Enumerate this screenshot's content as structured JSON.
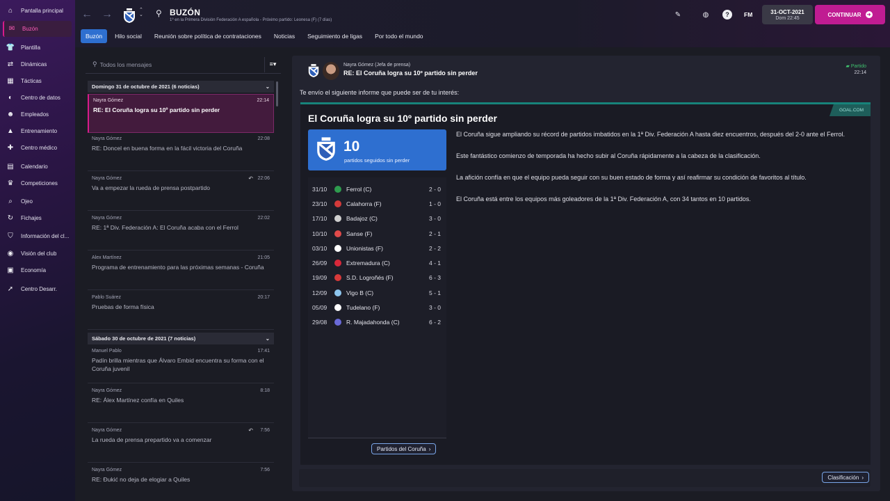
{
  "sidebar": {
    "items": [
      {
        "label": "Pantalla principal",
        "icon": "home-icon",
        "glyph": "⌂"
      },
      {
        "label": "Buzón",
        "icon": "inbox-icon",
        "glyph": "✉"
      },
      {
        "label": "Plantilla",
        "icon": "shirt-icon",
        "glyph": "👕"
      },
      {
        "label": "Dinámicas",
        "icon": "dynamics-icon",
        "glyph": "⇄"
      },
      {
        "label": "Tácticas",
        "icon": "tactics-icon",
        "glyph": "▦"
      },
      {
        "label": "Centro de datos",
        "icon": "data-hub-icon",
        "glyph": "◐"
      },
      {
        "label": "Empleados",
        "icon": "staff-icon",
        "glyph": "☻"
      },
      {
        "label": "Entrenamiento",
        "icon": "training-icon",
        "glyph": "▲"
      },
      {
        "label": "Centro médico",
        "icon": "medical-icon",
        "glyph": "✚"
      },
      {
        "label": "Calendario",
        "icon": "calendar-icon",
        "glyph": "▤"
      },
      {
        "label": "Competiciones",
        "icon": "trophy-icon",
        "glyph": "♛"
      },
      {
        "label": "Ojeo",
        "icon": "scouting-icon",
        "glyph": "⌕"
      },
      {
        "label": "Fichajes",
        "icon": "transfers-icon",
        "glyph": "↻"
      },
      {
        "label": "Información del cl...",
        "icon": "club-info-icon",
        "glyph": "⛉"
      },
      {
        "label": "Visión del club",
        "icon": "club-vision-icon",
        "glyph": "◉"
      },
      {
        "label": "Economía",
        "icon": "finances-icon",
        "glyph": "▣"
      },
      {
        "label": "Centro Desarr.",
        "icon": "development-icon",
        "glyph": "➚"
      }
    ]
  },
  "header": {
    "title": "BUZÓN",
    "subtitle": "1º en la Primera División Federación A española - Próximo partido: Leonesa (F)  (7 días)",
    "tabs": [
      "Buzón",
      "Hilo social",
      "Reunión sobre política de contrataciones",
      "Noticias",
      "Seguimiento de ligas",
      "Por todo el mundo"
    ],
    "fm_label": "FM",
    "date": "31-OCT-2021",
    "time": "Dom 22:45",
    "continue_label": "CONTINUAR"
  },
  "inbox": {
    "search_placeholder": "Todos los mensajes",
    "groups": [
      {
        "header": "Domingo 31 de octubre de 2021 (6 noticias)"
      },
      {
        "header": "Sábado 30 de octubre de 2021 (7 noticias)"
      }
    ],
    "messages": [
      {
        "from": "Nayra Gómez",
        "time": "22:14",
        "subject": "RE: El Coruña logra su 10º partido sin perder"
      },
      {
        "from": "Nayra Gómez",
        "time": "22:08",
        "subject": "RE: Doncel en buena forma en la fácil victoria del Coruña"
      },
      {
        "from": "Nayra Gómez",
        "time": "22:06",
        "subject": "Va a empezar la rueda de prensa postpartido"
      },
      {
        "from": "Nayra Gómez",
        "time": "22:02",
        "subject": "RE: 1ª Div. Federación A: El Coruña acaba con el Ferrol"
      },
      {
        "from": "Alex Martínez",
        "time": "21:05",
        "subject": "Programa de entrenamiento para las próximas semanas - Coruña"
      },
      {
        "from": "Pablo Suárez",
        "time": "20:17",
        "subject": "Pruebas de forma física"
      },
      {
        "from": "Manuel Pablo",
        "time": "17:41",
        "subject": "Padín brilla mientras que Álvaro Embid encuentra su forma con el Coruña juvenil"
      },
      {
        "from": "Nayra Gómez",
        "time": "8:18",
        "subject": "RE: Álex Martínez confía en Quiles"
      },
      {
        "from": "Nayra Gómez",
        "time": "7:56",
        "subject": "La rueda de prensa prepartido va a comenzar"
      },
      {
        "from": "Nayra Gómez",
        "time": "7:56",
        "subject": "RE: Đukić no deja de elogiar a Quiles"
      }
    ]
  },
  "message": {
    "from": "Nayra Gómez  (Jefa de prensa)",
    "subject": "RE: El Coruña logra su 10º partido sin perder",
    "tag": "Partido",
    "time": "22:14",
    "intro": "Te envío el siguiente informe que puede ser de tu interés:",
    "source": "GOAL.COM",
    "article_title": "El Coruña logra su 10º partido sin perder",
    "stat_value": "10",
    "stat_label": "partidos seguidos sin perder",
    "fixtures": [
      {
        "date": "31/10",
        "opponent": "Ferrol (C)",
        "score": "2 - 0",
        "color": "#2e9b4e"
      },
      {
        "date": "23/10",
        "opponent": "Calahorra (F)",
        "score": "1 - 0",
        "color": "#d33a3a"
      },
      {
        "date": "17/10",
        "opponent": "Badajoz (C)",
        "score": "3 - 0",
        "color": "#cfcfcf"
      },
      {
        "date": "10/10",
        "opponent": "Sanse (F)",
        "score": "2 - 1",
        "color": "#e04a4a"
      },
      {
        "date": "03/10",
        "opponent": "Unionistas (F)",
        "score": "2 - 2",
        "color": "#ffffff"
      },
      {
        "date": "26/09",
        "opponent": "Extremadura (C)",
        "score": "4 - 1",
        "color": "#d8283a"
      },
      {
        "date": "19/09",
        "opponent": "S.D. Logroñés (F)",
        "score": "6 - 3",
        "color": "#d83a3a"
      },
      {
        "date": "12/09",
        "opponent": "Vigo B (C)",
        "score": "5 - 1",
        "color": "#8ec6ee"
      },
      {
        "date": "05/09",
        "opponent": "Tudelano (F)",
        "score": "3 - 0",
        "color": "#ffffff"
      },
      {
        "date": "29/08",
        "opponent": "R. Majadahonda (C)",
        "score": "6 - 2",
        "color": "#6a6ad8"
      }
    ],
    "fixtures_button": "Partidos del Coruña",
    "paragraphs": [
      "El Coruña sigue ampliando su récord de partidos imbatidos en la 1ª Div. Federación A hasta diez encuentros, después del 2-0 ante el Ferrol.",
      "Este fantástico comienzo de temporada ha hecho subir al Coruña rápidamente a la cabeza de la clasificación.",
      "La afición confía en que el equipo pueda seguir con su buen estado de forma y así reafirmar su condición de favoritos al título.",
      "El Coruña está entre los equipos más goleadores de la 1ª Div. Federación A, con 34 tantos en 10 partidos."
    ],
    "table_button": "Clasificación"
  }
}
